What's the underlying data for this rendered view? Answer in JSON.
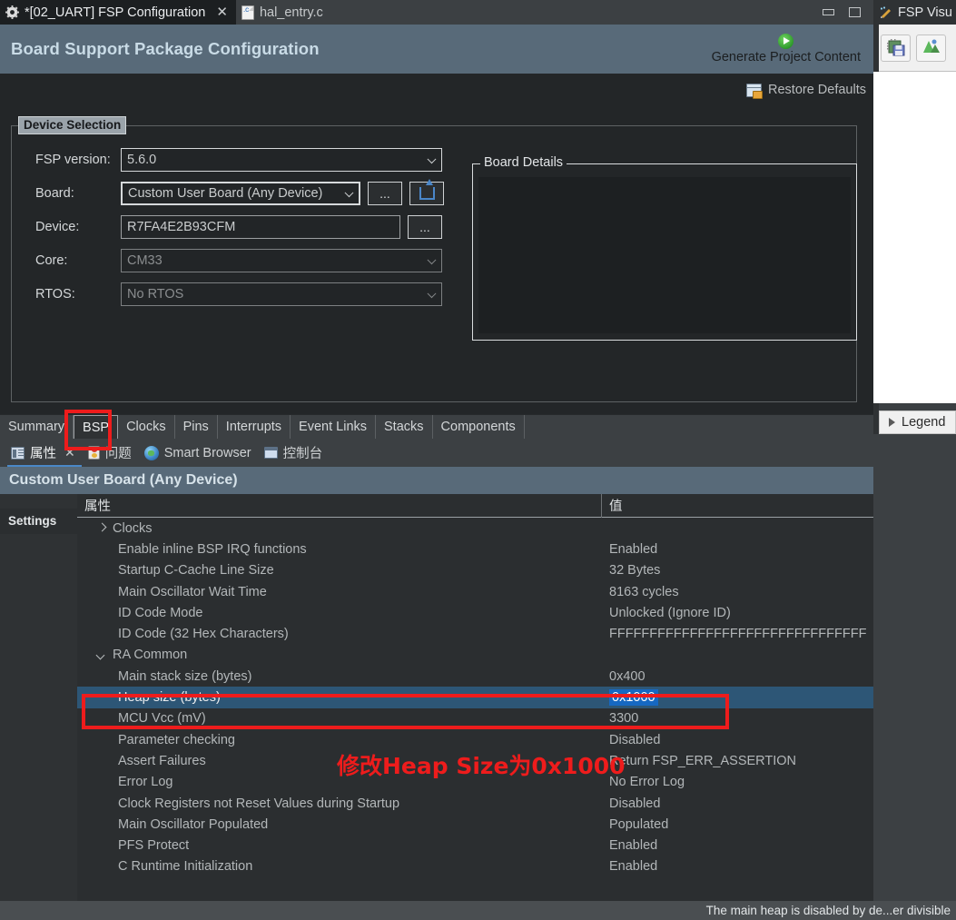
{
  "window": {
    "tabs": [
      {
        "label": "*[02_UART] FSP Configuration",
        "icon": "gear-icon",
        "active": true,
        "closable": true
      },
      {
        "label": "hal_entry.c",
        "icon": "c-file-icon",
        "active": false,
        "closable": false
      }
    ],
    "controls": {
      "minimize": "minimize",
      "maximize": "maximize"
    }
  },
  "bsp": {
    "title": "Board Support Package Configuration",
    "generate_label": "Generate Project Content",
    "generate_icon": "play-icon",
    "restore_label": "Restore Defaults",
    "restore_icon": "restore-defaults-icon"
  },
  "device_selection": {
    "group_title": "Device Selection",
    "fields": [
      {
        "label": "FSP version:",
        "value": "5.6.0",
        "type": "combo",
        "disabled": false
      },
      {
        "label": "Board:",
        "value": "Custom User Board (Any Device)",
        "type": "combo-with-buttons",
        "disabled": false
      },
      {
        "label": "Device:",
        "value": "R7FA4E2B93CFM",
        "type": "text-with-button",
        "disabled": true
      },
      {
        "label": "Core:",
        "value": "CM33",
        "type": "combo",
        "disabled": true
      },
      {
        "label": "RTOS:",
        "value": "No RTOS",
        "type": "combo",
        "disabled": true
      }
    ],
    "browse_label": "...",
    "import_icon": "import-board-icon"
  },
  "board_details": {
    "title": "Board Details",
    "content": ""
  },
  "editor_tabs": [
    {
      "label": "Summary",
      "selected": false
    },
    {
      "label": "BSP",
      "selected": true
    },
    {
      "label": "Clocks",
      "selected": false
    },
    {
      "label": "Pins",
      "selected": false
    },
    {
      "label": "Interrupts",
      "selected": false
    },
    {
      "label": "Event Links",
      "selected": false
    },
    {
      "label": "Stacks",
      "selected": false
    },
    {
      "label": "Components",
      "selected": false
    }
  ],
  "properties_view": {
    "tabs": [
      {
        "label": "属性",
        "icon": "properties-icon",
        "active": true,
        "closable": true
      },
      {
        "label": "问题",
        "icon": "problems-icon",
        "active": false,
        "closable": false
      },
      {
        "label": "Smart Browser",
        "icon": "smart-browser-icon",
        "active": false,
        "closable": false
      },
      {
        "label": "控制台",
        "icon": "console-icon",
        "active": false,
        "closable": false
      }
    ],
    "header_title": "Custom User Board (Any Device)",
    "side_tab": "Settings",
    "columns": {
      "property": "属性",
      "value": "值"
    },
    "rows": [
      {
        "property": "Clocks",
        "value": "",
        "indent": 1,
        "twisty": "closed"
      },
      {
        "property": "Enable inline BSP IRQ functions",
        "value": "Enabled",
        "indent": 2
      },
      {
        "property": "Startup C-Cache Line Size",
        "value": "32 Bytes",
        "indent": 2
      },
      {
        "property": "Main Oscillator Wait Time",
        "value": "8163 cycles",
        "indent": 2
      },
      {
        "property": "ID Code Mode",
        "value": "Unlocked (Ignore ID)",
        "indent": 2
      },
      {
        "property": "ID Code (32 Hex Characters)",
        "value": "FFFFFFFFFFFFFFFFFFFFFFFFFFFFFFFF",
        "indent": 2
      },
      {
        "property": "RA Common",
        "value": "",
        "indent": 1,
        "twisty": "open"
      },
      {
        "property": "Main stack size (bytes)",
        "value": "0x400",
        "indent": 2
      },
      {
        "property": "Heap size (bytes)",
        "value": "0x1000",
        "indent": 2,
        "selected": true,
        "editing": true
      },
      {
        "property": "MCU Vcc (mV)",
        "value": "3300",
        "indent": 2
      },
      {
        "property": "Parameter checking",
        "value": "Disabled",
        "indent": 2
      },
      {
        "property": "Assert Failures",
        "value": "Return FSP_ERR_ASSERTION",
        "indent": 2
      },
      {
        "property": "Error Log",
        "value": "No Error Log",
        "indent": 2
      },
      {
        "property": "Clock Registers not Reset Values during Startup",
        "value": "Disabled",
        "indent": 2
      },
      {
        "property": "Main Oscillator Populated",
        "value": "Populated",
        "indent": 2
      },
      {
        "property": "PFS Protect",
        "value": "Enabled",
        "indent": 2
      },
      {
        "property": "C Runtime Initialization",
        "value": "Enabled",
        "indent": 2
      }
    ]
  },
  "status_bar": {
    "text": "The main heap is disabled by de...er divisible"
  },
  "right_pane": {
    "tab_label": "FSP Visu",
    "tab_icon": "fsp-visualization-icon",
    "toolbar": [
      {
        "icon": "save-chip-icon",
        "name": "export-image-button"
      },
      {
        "icon": "chart-icon",
        "name": "graph-button"
      }
    ],
    "legend_label": "Legend",
    "legend_icon": "expand-arrow-icon"
  },
  "annotations": [
    {
      "type": "rect",
      "target": "bsp-editor-tab",
      "color": "#ee1c1c"
    },
    {
      "type": "rect",
      "target": "heap-size-row",
      "color": "#ee1c1c"
    },
    {
      "type": "text",
      "text": "修改Heap Size为0x1000",
      "color": "#ee1c1c"
    }
  ],
  "colors": {
    "accent_blue": "#1668c2",
    "selection_blue": "#2d5676",
    "header_band": "#586a79",
    "annotation_red": "#ee1c1c",
    "panel_bg": "#2b2e30",
    "window_bg": "#2f3234"
  }
}
